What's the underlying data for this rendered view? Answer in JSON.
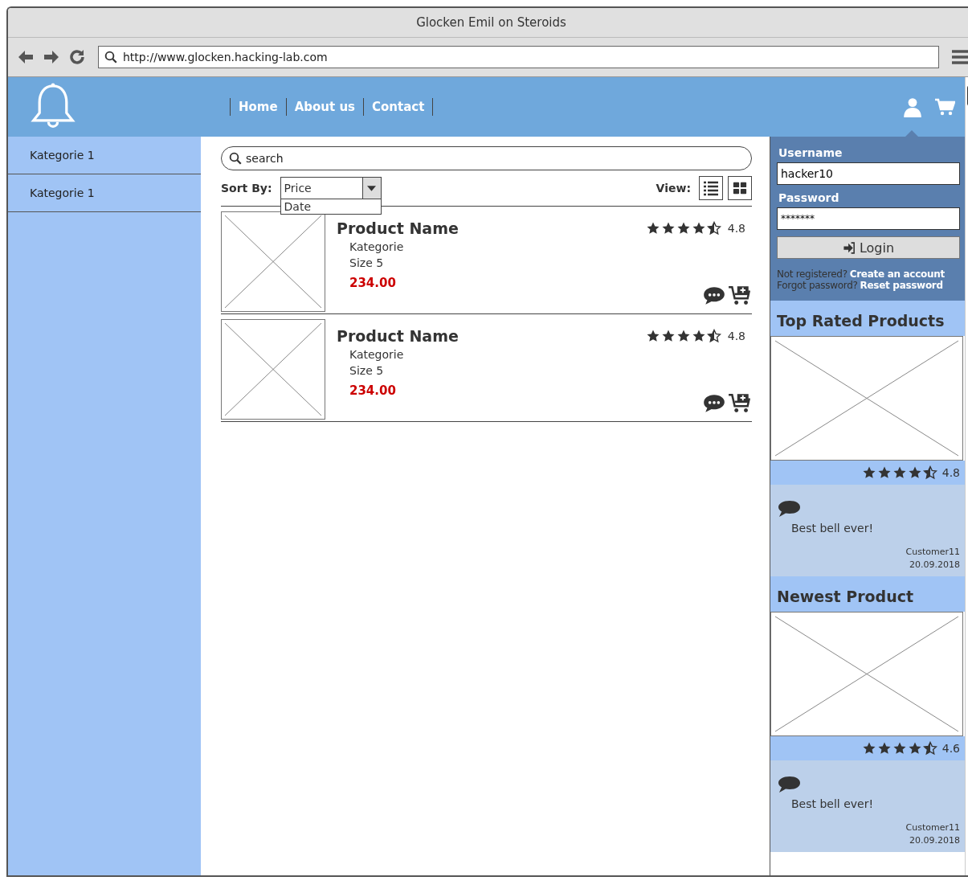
{
  "window": {
    "title": "Glocken Emil on Steroids"
  },
  "browser": {
    "url": "http://www.glocken.hacking-lab.com"
  },
  "nav": [
    "Home",
    "About us",
    "Contact"
  ],
  "sidebar": {
    "items": [
      {
        "label": "Kategorie 1"
      },
      {
        "label": "Kategorie 1"
      }
    ]
  },
  "search": {
    "placeholder": "search"
  },
  "sort": {
    "label": "Sort By:",
    "value": "Price",
    "options": [
      "Date"
    ]
  },
  "view": {
    "label": "View:",
    "modes": [
      {
        "kind": "list"
      },
      {
        "kind": "grid"
      }
    ]
  },
  "products": [
    {
      "name": "Product Name",
      "category": "Kategorie",
      "size": "Size 5",
      "price": "234.00",
      "stars": 4.5,
      "rating": "4.8"
    },
    {
      "name": "Product Name",
      "category": "Kategorie",
      "size": "Size 5",
      "price": "234.00",
      "stars": 4.5,
      "rating": "4.8"
    }
  ],
  "login": {
    "username_label": "Username",
    "username": "hacker10",
    "password_label": "Password",
    "password": "*******",
    "button": "Login",
    "register_text": "Not registered?",
    "register_link": "Create an account",
    "forgot_text": "Forgot password?",
    "forgot_link": "Reset password"
  },
  "highlights": [
    {
      "title": "Top Rated Products",
      "stars": 4.5,
      "rating": "4.8",
      "review": "Best bell ever!",
      "customer": "Customer11",
      "date": "20.09.2018"
    },
    {
      "title": "Newest Product",
      "stars": 4.5,
      "rating": "4.6",
      "review": "Best bell ever!",
      "customer": "Customer11",
      "date": "20.09.2018"
    }
  ]
}
